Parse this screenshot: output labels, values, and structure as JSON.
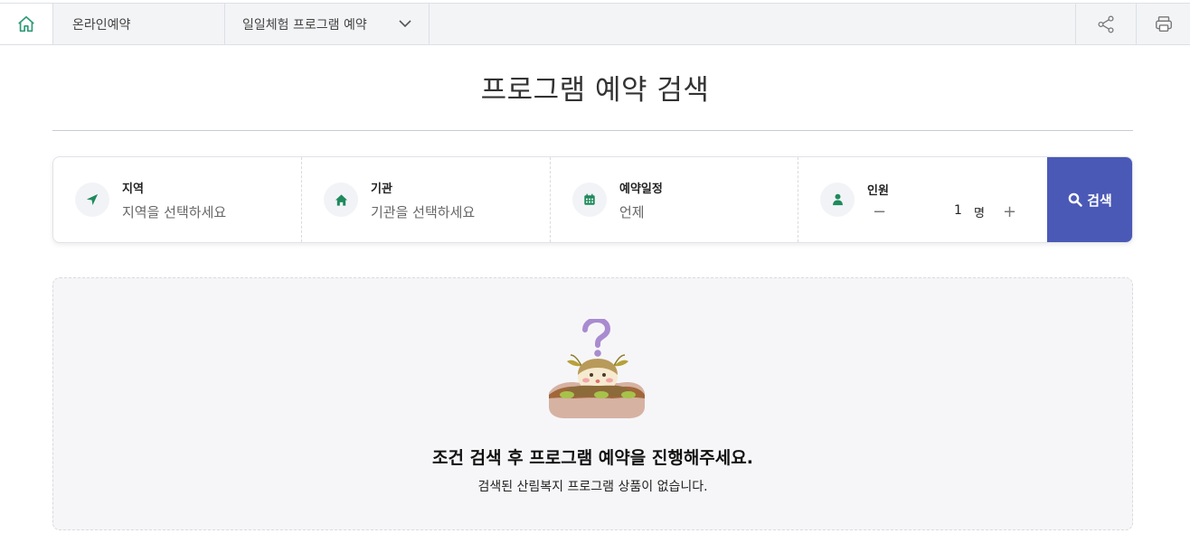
{
  "nav": {
    "home_icon": "home-icon",
    "crumb1": "온라인예약",
    "crumb2": "일일체험 프로그램 예약",
    "share_icon": "share-icon",
    "print_icon": "print-icon"
  },
  "page": {
    "title": "프로그램 예약 검색"
  },
  "search": {
    "region": {
      "label": "지역",
      "placeholder": "지역을 선택하세요",
      "icon": "location-arrow-icon"
    },
    "org": {
      "label": "기관",
      "placeholder": "기관을 선택하세요",
      "icon": "home-icon"
    },
    "schedule": {
      "label": "예약일정",
      "value": "언제",
      "icon": "calendar-icon"
    },
    "people": {
      "label": "인원",
      "count": "1",
      "unit": "명",
      "minus": "−",
      "plus": "+",
      "icon": "person-icon"
    },
    "button_label": "검색"
  },
  "result": {
    "message": "조건 검색 후 프로그램 예약을 진행해주세요.",
    "sub_message": "검색된 산림복지 프로그램 상품이 없습니다."
  },
  "colors": {
    "accent": "#4a59b6",
    "icon_green": "#1e8a5c"
  }
}
